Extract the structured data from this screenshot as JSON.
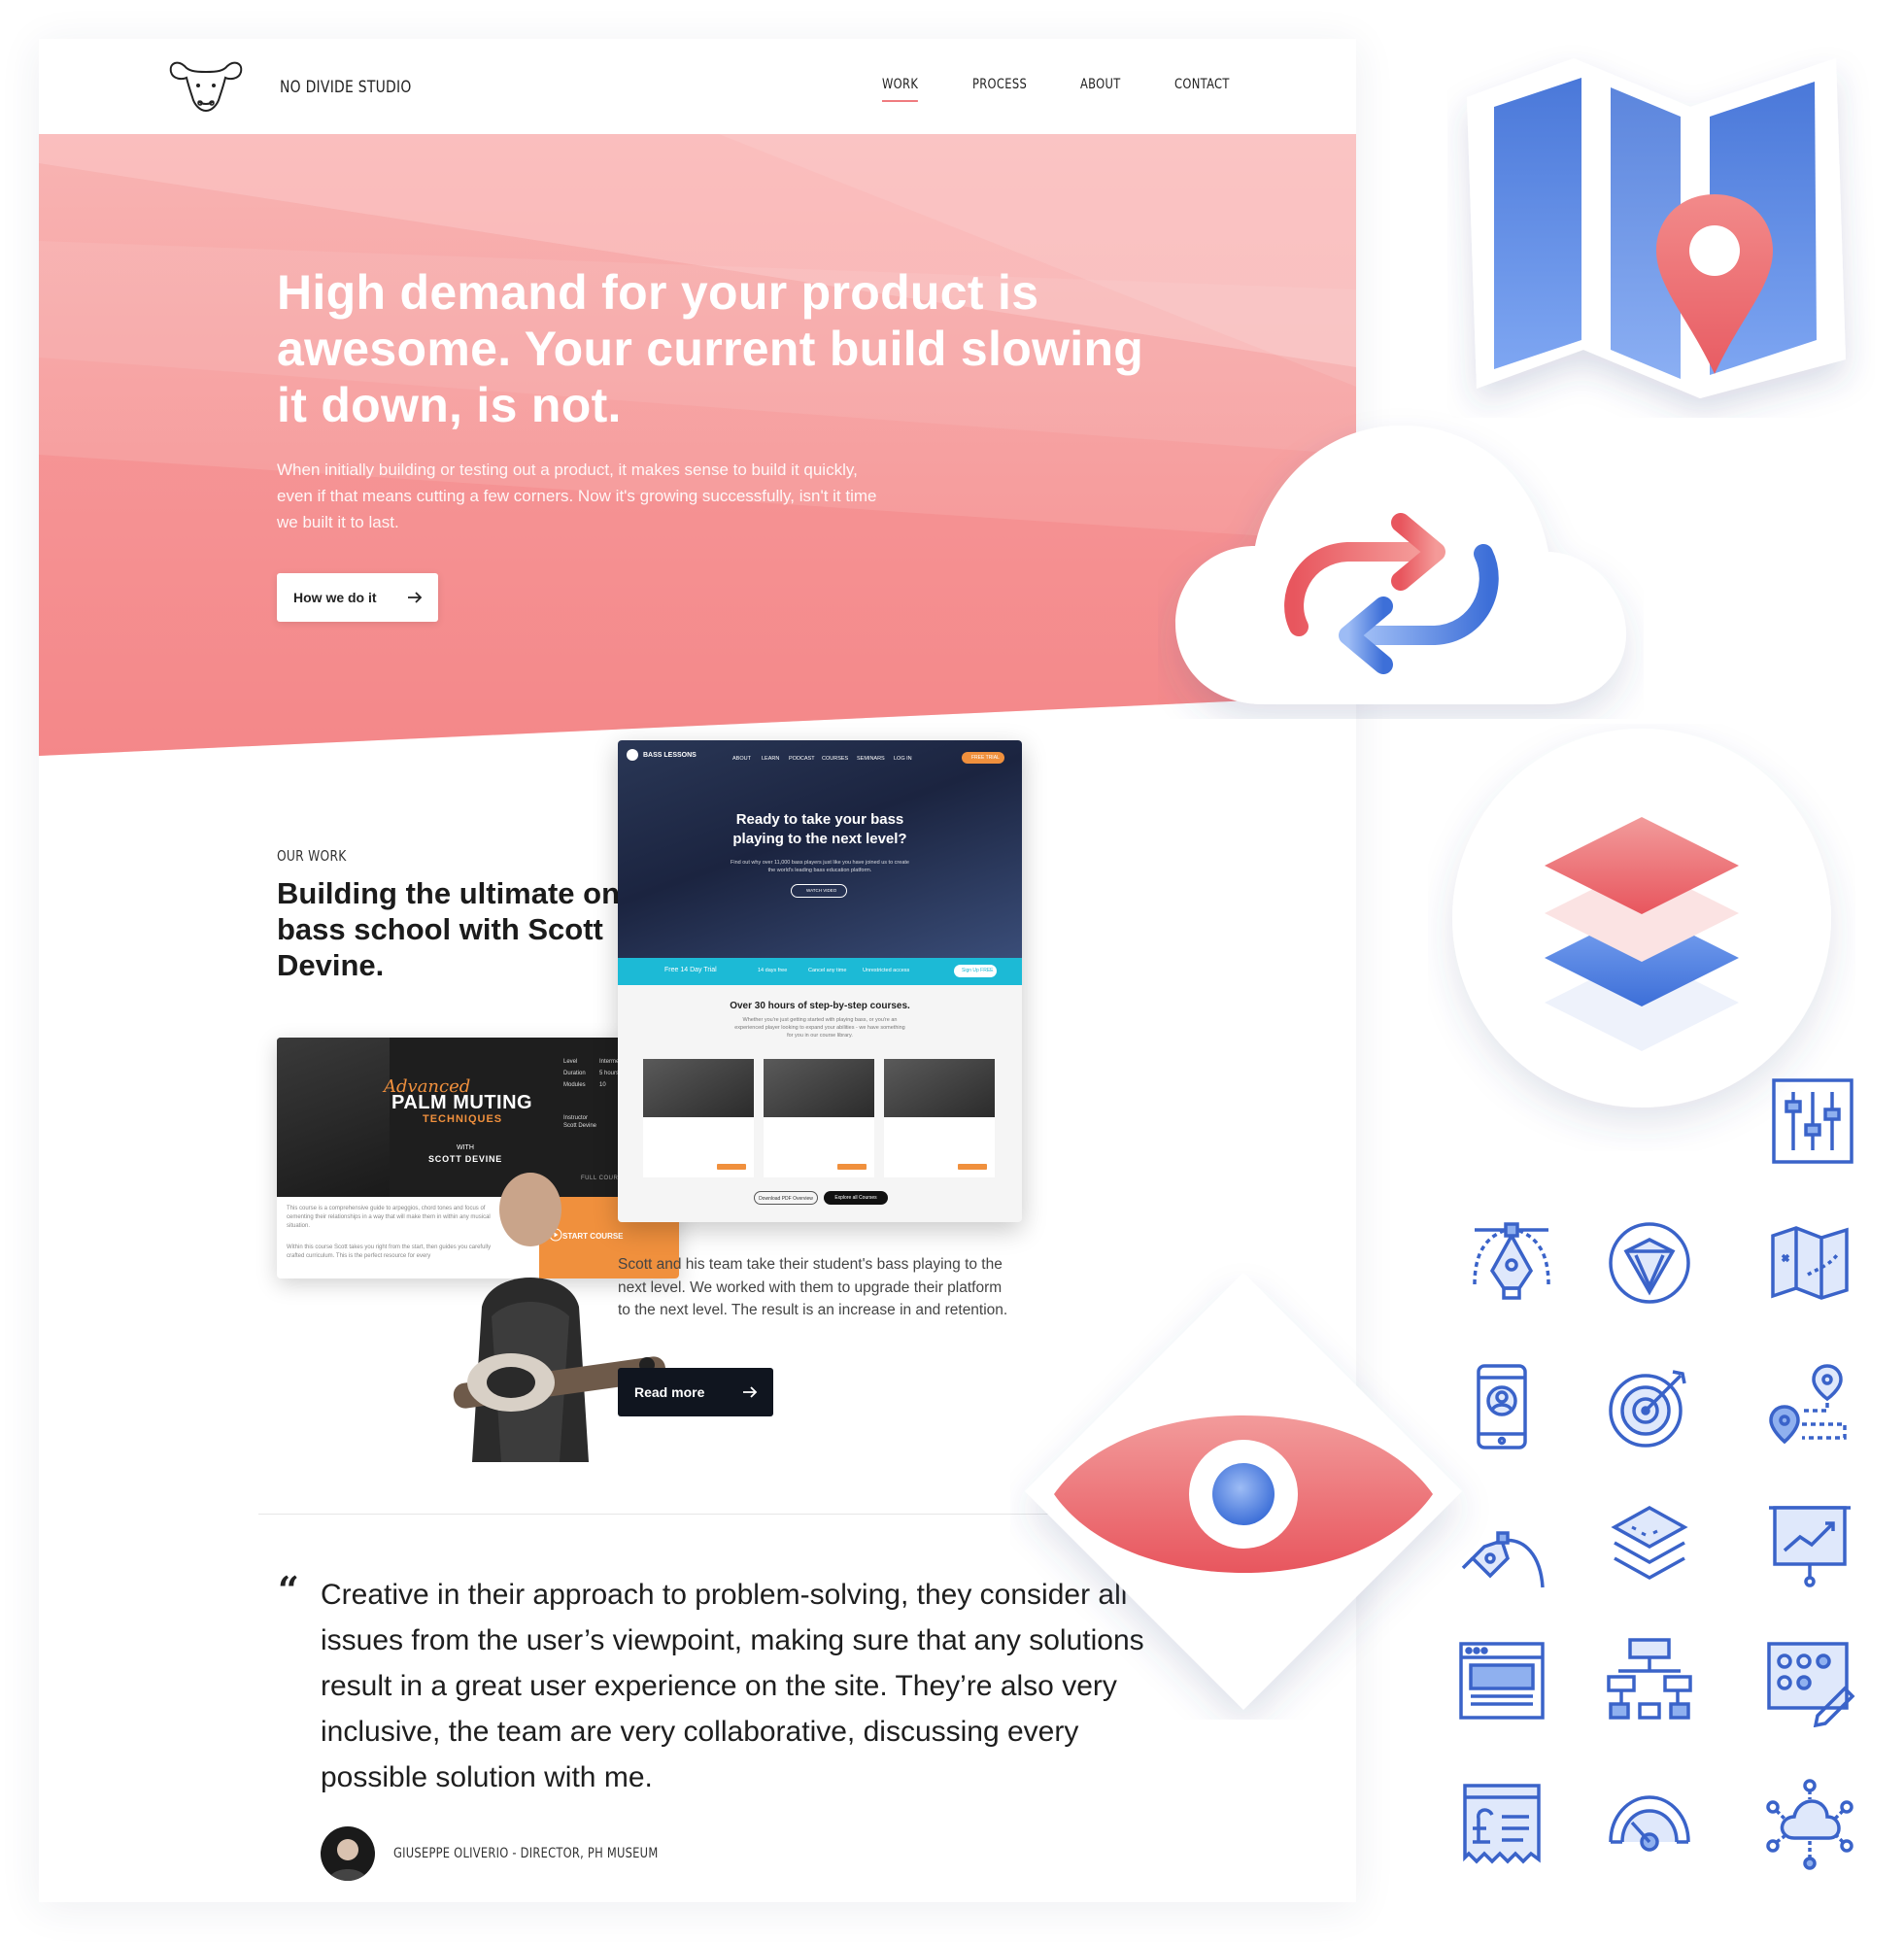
{
  "nav": {
    "brand": "NO DIVIDE STUDIO",
    "items": [
      {
        "label": "WORK",
        "active": true
      },
      {
        "label": "PROCESS",
        "active": false
      },
      {
        "label": "ABOUT",
        "active": false
      },
      {
        "label": "CONTACT",
        "active": false
      }
    ]
  },
  "hero": {
    "title": "High demand for your product is awesome. Your current build slowing it down, is not.",
    "text": "When initially building or testing out a product, it makes sense to build it quickly, even if that means cutting a few corners. Now it's growing successfully, isn't it time we built it to last.",
    "cta": "How we do it",
    "color": "#f7a1a1"
  },
  "work": {
    "eyebrow": "OUR WORK",
    "title": "Building the ultimate online bass school with Scott Devine.",
    "description": "Scott and his team take their student's bass playing to the next level. We worked with them to upgrade their platform to the next level. The result is an increase in and retention.",
    "cta": "Read more"
  },
  "course_card": {
    "script": "Advanced",
    "title": "PALM MUTING",
    "subtitle": "TECHNIQUES",
    "with": "WITH",
    "name": "SCOTT DEVINE",
    "level_label": "Level",
    "level": "Intermediate",
    "duration_label": "Duration",
    "duration": "5 hours",
    "modules_label": "Modules",
    "modules": "10",
    "instructor_label": "Instructor",
    "instructor": "Scott Devine",
    "details": "FULL COURSE DETAILS",
    "start": "START COURSE",
    "para1": "This course is a comprehensive guide to arpeggios, chord tones and focus of cementing their relationships in a way that will make them in within any musical situation.",
    "para2": "Within this course Scott takes you right from the start, then guides you carefully crafted curriculum. This is the perfect resource for every"
  },
  "mockup": {
    "logo": "BASS LESSONS",
    "nav": [
      "ABOUT",
      "LEARN",
      "PODCAST",
      "COURSES",
      "SEMINARS",
      "LOG IN"
    ],
    "cta": "FREE TRIAL",
    "headline": "Ready to take your bass playing to the next level?",
    "sub": "Find out why over 11,000 bass players just like you have joined us to create the world's leading bass education platform.",
    "watch": "WATCH VIDEO",
    "strip": [
      "Free 14 Day Trial",
      "14 days free",
      "Cancel any time",
      "Unrestricted access"
    ],
    "signup": "Sign Up FREE",
    "section_title": "Over 30 hours of step-by-step courses.",
    "section_text": "Whether you're just getting started with playing bass, or you're an experienced player looking to expand your abilities - we have something for you in our course library.",
    "btn_pdf": "Download PDF Overview",
    "btn_all": "Explore all Courses"
  },
  "testimonial": {
    "mark": "“",
    "quote": "Creative in their approach to problem-solving, they consider all issues from the user’s viewpoint, making sure that any solutions result in a great user experience on the site. They’re also very inclusive, the team are very collaborative, discussing every possible solution with me.",
    "author": "GIUSEPPE OLIVERIO - DIRECTOR, PH MUSEUM"
  },
  "decor_icons": [
    "map-icon",
    "cloud-sync-icon",
    "layers-icon",
    "eye-icon",
    "sliders-icon",
    "pen-tool-icon",
    "pencil-badge-icon",
    "folded-map-icon",
    "mobile-user-icon",
    "target-icon",
    "route-icon",
    "compass-pen-icon",
    "stack-icon",
    "presentation-chart-icon",
    "browser-layout-icon",
    "sitemap-icon",
    "settings-edit-icon",
    "invoice-icon",
    "gauge-icon",
    "cloud-network-icon"
  ],
  "colors": {
    "accent_red": "#ef6f74",
    "accent_blue": "#3d6fd8",
    "icon_blue": "#3a63c9",
    "orange": "#f0903d",
    "dark": "#10151f"
  }
}
